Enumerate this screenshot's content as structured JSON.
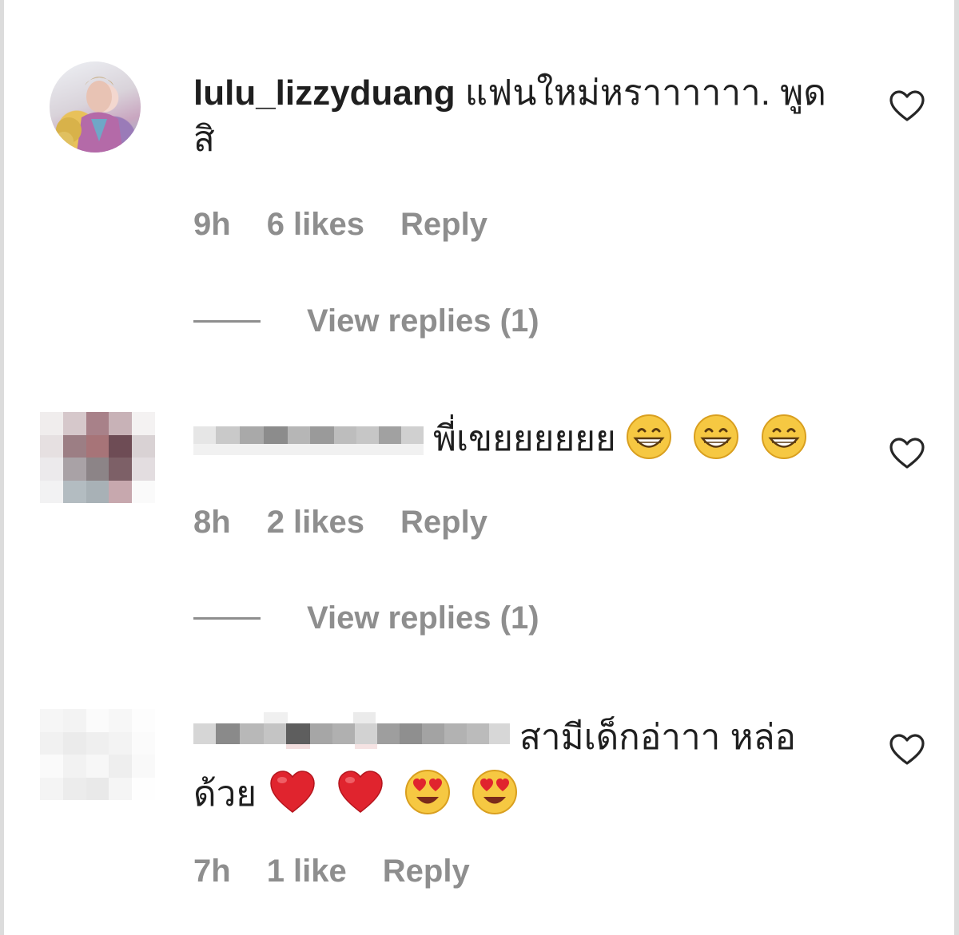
{
  "comments": [
    {
      "username": "lulu_lizzyduang",
      "text": " แฟนใหม่หราาาาาา. พูดสิ",
      "time": "9h",
      "likes": "6 likes",
      "reply_label": "Reply",
      "view_replies": "View replies (1)",
      "liked": false
    },
    {
      "username": "",
      "text": "พี่เขยยยยยย",
      "emojis": [
        "grinning-face-emoji",
        "grinning-face-emoji",
        "grinning-face-emoji"
      ],
      "time": "8h",
      "likes": "2 likes",
      "reply_label": "Reply",
      "view_replies": "View replies (1)",
      "liked": false
    },
    {
      "username": "",
      "text": "สามีเด็กอ่าาา หล่อ",
      "text_line2": "ด้วย",
      "emojis": [
        "red-heart-emoji",
        "red-heart-emoji",
        "heart-eyes-emoji",
        "heart-eyes-emoji"
      ],
      "time": "7h",
      "likes": "1 like",
      "reply_label": "Reply",
      "liked": false
    }
  ],
  "colors": {
    "meta_gray": "#8e8e8e",
    "text": "#1f1f1f",
    "heart_outline": "#262626",
    "frame": "#dcdcdc"
  },
  "icons": [
    "heart-outline-icon",
    "grinning-face-emoji",
    "red-heart-emoji",
    "heart-eyes-emoji"
  ]
}
